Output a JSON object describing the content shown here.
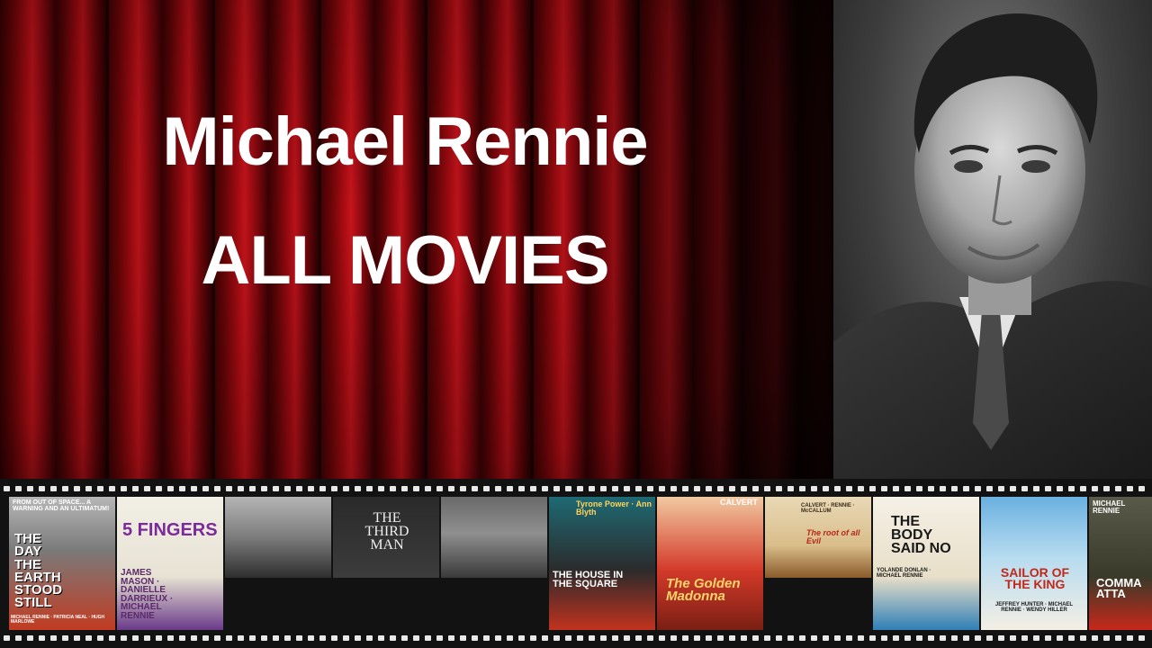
{
  "title": {
    "line1": "Michael Rennie",
    "line2": "ALL MOVIES"
  },
  "portrait": {
    "subject": "black-and-white portrait photo"
  },
  "posters": [
    {
      "name": "poster-day-the-earth-stood-still",
      "text": "THE DAY THE EARTH STOOD STILL",
      "tagline": "FROM OUT OF SPACE... A WARNING AND AN ULTIMATUM!",
      "credits": "MICHAEL RENNIE · PATRICIA NEAL · HUGH MARLOWE"
    },
    {
      "name": "poster-5-fingers",
      "text": "5 FINGERS",
      "credits": "JAMES MASON · DANIELLE DARRIEUX · MICHAEL RENNIE"
    },
    {
      "name": "poster-still-street-scene",
      "text": ""
    },
    {
      "name": "poster-the-third-man",
      "text": "THE THIRD MAN"
    },
    {
      "name": "poster-still-wagon",
      "text": ""
    },
    {
      "name": "poster-house-in-the-square",
      "text": "THE HOUSE IN THE SQUARE",
      "credits": "Tyrone Power · Ann Blyth"
    },
    {
      "name": "poster-golden-madonna",
      "text": "The Golden Madonna",
      "credits": "CALVERT"
    },
    {
      "name": "poster-root-of-all-evil",
      "text": "The root of all Evil",
      "credits": "CALVERT · RENNIE · McCALLUM"
    },
    {
      "name": "poster-body-said-no",
      "text": "THE BODY SAID NO",
      "credits": "YOLANDE DONLAN · MICHAEL RENNIE"
    },
    {
      "name": "poster-sailor-of-the-king",
      "text": "SAILOR OF THE KING",
      "credits": "JEFFREY HUNTER · MICHAEL RENNIE · WENDY HILLER"
    },
    {
      "name": "poster-commando-attack",
      "text": "COMMA ATTA",
      "credits": "MICHAEL RENNIE"
    }
  ]
}
